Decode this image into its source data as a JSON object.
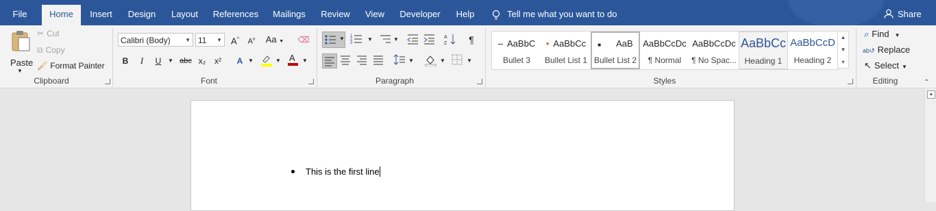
{
  "tabs": [
    "File",
    "Home",
    "Insert",
    "Design",
    "Layout",
    "References",
    "Mailings",
    "Review",
    "View",
    "Developer",
    "Help"
  ],
  "active_tab": "Home",
  "tell_me": "Tell me what you want to do",
  "share": "Share",
  "clipboard": {
    "paste": "Paste",
    "cut": "Cut",
    "copy": "Copy",
    "format_painter": "Format Painter",
    "label": "Clipboard"
  },
  "font": {
    "name": "Calibri (Body)",
    "size": "11",
    "label": "Font",
    "grow": "A",
    "shrink": "A",
    "case": "Aa",
    "bold": "B",
    "italic": "I",
    "underline": "U",
    "strike": "abc",
    "sub": "x₂",
    "sup": "x²"
  },
  "paragraph": {
    "label": "Paragraph",
    "pilcrow": "¶"
  },
  "styles": {
    "label": "Styles",
    "items": [
      {
        "preview": "AaBbC",
        "name": "Bullet 3"
      },
      {
        "preview": "AaBbCc",
        "name": "Bullet List 1"
      },
      {
        "preview": "AaB",
        "name": "Bullet List 2"
      },
      {
        "preview": "AaBbCcDc",
        "name": "¶ Normal"
      },
      {
        "preview": "AaBbCcDc",
        "name": "¶ No Spac..."
      },
      {
        "preview": "AaBbCc",
        "name": "Heading 1"
      },
      {
        "preview": "AaBbCcD",
        "name": "Heading 2"
      }
    ]
  },
  "editing": {
    "find": "Find",
    "replace": "Replace",
    "select": "Select",
    "label": "Editing"
  },
  "document": {
    "line1": "This is the first line"
  },
  "colors": {
    "brand": "#2b579a",
    "highlight": "#ffff00",
    "font_color": "#c00000"
  }
}
